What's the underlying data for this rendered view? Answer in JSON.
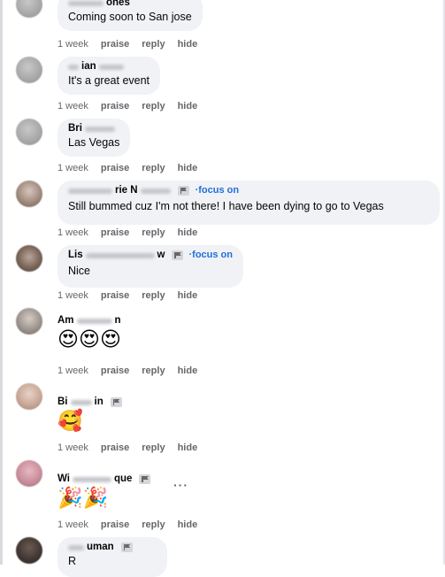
{
  "comments": [
    {
      "name_visible": "ones",
      "text": "Coming soon to San jose",
      "time": "1 week",
      "actions": [
        "praise",
        "reply",
        "hide"
      ]
    },
    {
      "name_visible": "ian",
      "text": "It's a great event",
      "time": "1 week",
      "actions": [
        "praise",
        "reply",
        "hide"
      ]
    },
    {
      "name_visible": "Bri",
      "text": "Las Vegas",
      "time": "1 week",
      "actions": [
        "praise",
        "reply",
        "hide"
      ]
    },
    {
      "name_visible": "rie N",
      "focus": "·focus on",
      "text": "Still bummed cuz I'm not there! I have been dying to go to Vegas",
      "time": "1 week",
      "actions": [
        "praise",
        "reply",
        "hide"
      ]
    },
    {
      "name_visible": "Lis",
      "name_end": "w",
      "focus": "·focus on",
      "text": "Nice",
      "time": "1 week",
      "actions": [
        "praise",
        "reply",
        "hide"
      ]
    },
    {
      "name_visible": "Am",
      "name_end": "n",
      "emoji": "😍😍😍",
      "time": "1 week",
      "actions": [
        "praise",
        "reply",
        "hide"
      ]
    },
    {
      "name_visible": "Bi",
      "name_end": "in",
      "emoji": "🥰",
      "time": "1 week",
      "actions": [
        "praise",
        "reply",
        "hide"
      ]
    },
    {
      "name_visible": "Wi",
      "name_end": "que",
      "emoji": "🎉🎉",
      "more": "···",
      "time": "1 week",
      "actions": [
        "praise",
        "reply",
        "hide"
      ]
    },
    {
      "name_visible": "uman",
      "text": "R"
    }
  ]
}
